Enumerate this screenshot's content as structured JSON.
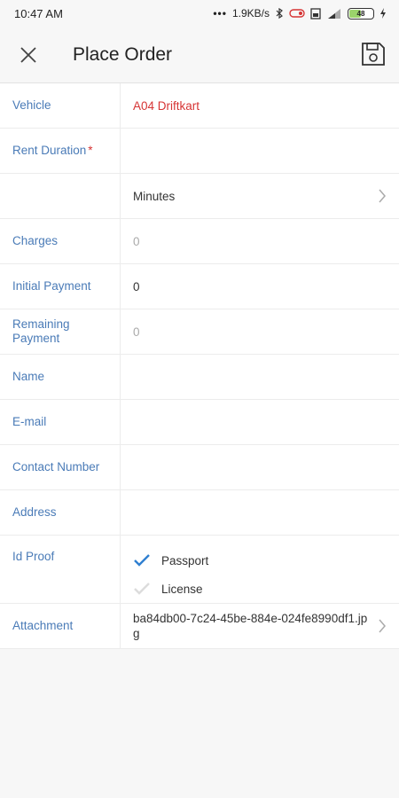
{
  "status": {
    "time": "10:47 AM",
    "network_speed": "1.9KB/s",
    "battery": "48"
  },
  "header": {
    "title": "Place Order"
  },
  "form": {
    "vehicle": {
      "label": "Vehicle",
      "value": "A04 Driftkart"
    },
    "rent_duration": {
      "label": "Rent Duration",
      "required_mark": "*",
      "value": ""
    },
    "duration_unit": {
      "value": "Minutes"
    },
    "charges": {
      "label": "Charges",
      "value": "0"
    },
    "initial_payment": {
      "label": "Initial Payment",
      "value": "0"
    },
    "remaining_payment": {
      "label": "Remaining Payment",
      "value": "0"
    },
    "name": {
      "label": "Name",
      "value": ""
    },
    "email": {
      "label": "E-mail",
      "value": ""
    },
    "contact_number": {
      "label": "Contact Number",
      "value": ""
    },
    "address": {
      "label": "Address",
      "value": ""
    },
    "id_proof": {
      "label": "Id Proof",
      "options": [
        {
          "label": "Passport",
          "checked": true
        },
        {
          "label": "License",
          "checked": false
        }
      ]
    },
    "attachment": {
      "label": "Attachment",
      "value": "ba84db00-7c24-45be-884e-024fe8990df1.jpg"
    }
  },
  "colors": {
    "label_blue": "#4a7bb7",
    "accent_red": "#d63434",
    "check_blue": "#2f7fd0"
  },
  "icons": [
    "close-icon",
    "save-icon",
    "chevron-right-icon",
    "check-icon"
  ]
}
